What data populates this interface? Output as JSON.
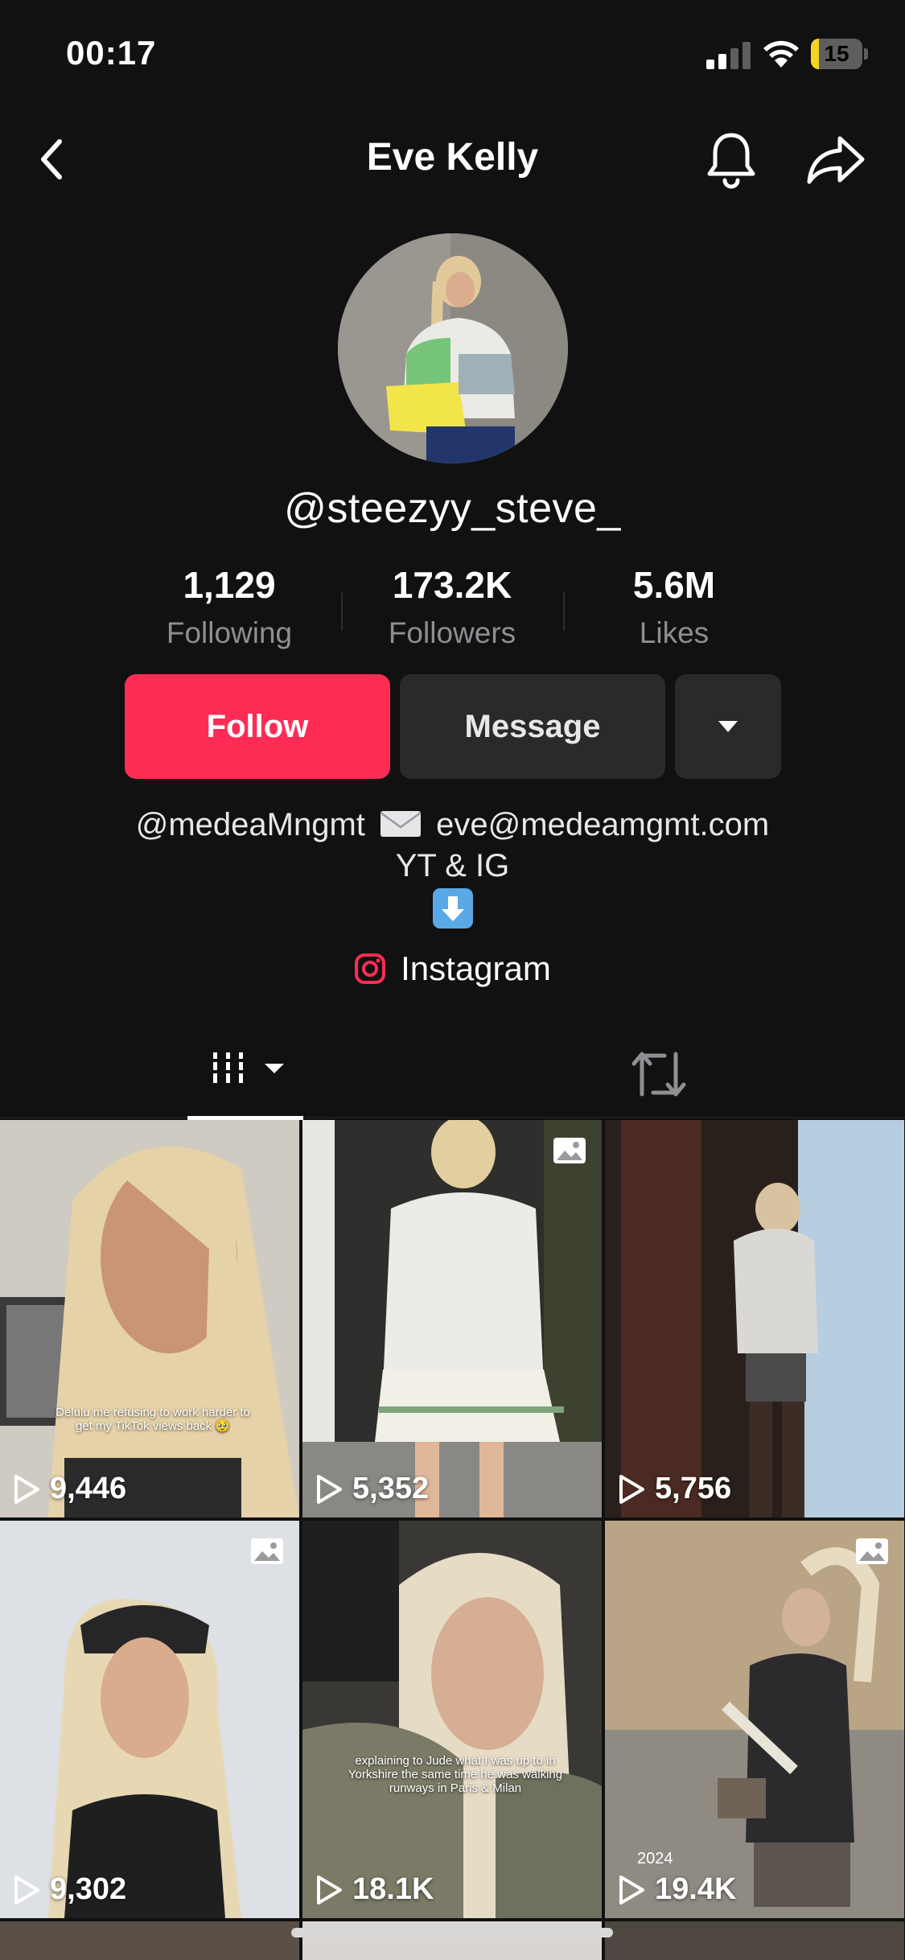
{
  "status_bar": {
    "time": "00:17",
    "battery": "15",
    "battery_level": 0.15
  },
  "header": {
    "title": "Eve Kelly"
  },
  "profile": {
    "username": "@steezyy_steve_",
    "stats": [
      {
        "value": "1,129",
        "label": "Following"
      },
      {
        "value": "173.2K",
        "label": "Followers"
      },
      {
        "value": "5.6M",
        "label": "Likes"
      }
    ],
    "buttons": {
      "follow": "Follow",
      "message": "Message"
    },
    "bio": {
      "line1_handle": "@medeaMngmt",
      "line1_email": "eve@medeamgmt.com",
      "line2": "YT & IG"
    },
    "link": {
      "label": "Instagram"
    }
  },
  "grid": [
    {
      "views": "9,446",
      "caption": "Delulu me refusing to work harder to get my TikTok views back 🥹",
      "type": "video"
    },
    {
      "views": "5,352",
      "caption": "",
      "type": "photo"
    },
    {
      "views": "5,756",
      "caption": "",
      "type": "video"
    },
    {
      "views": "9,302",
      "caption": "",
      "type": "photo"
    },
    {
      "views": "18.1K",
      "caption": "explaining to Jude what I was up to in Yorkshire the same time he was walking runways in Paris & Milan",
      "type": "video"
    },
    {
      "views": "19.4K",
      "caption": "2024",
      "type": "photo"
    }
  ],
  "colors": {
    "accent": "#fe2c55",
    "background": "#111112",
    "button_secondary": "#2a2a2c"
  }
}
